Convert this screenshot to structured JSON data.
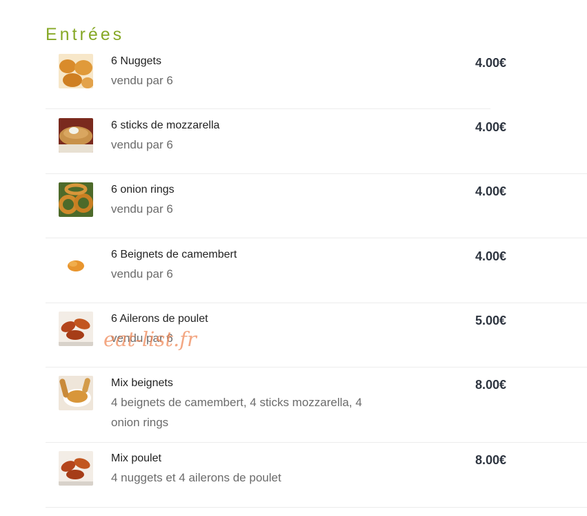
{
  "section": {
    "title": "Entrées"
  },
  "items": [
    {
      "name": "6 Nuggets",
      "description": "vendu par 6",
      "price": "4.00€",
      "thumb_icon": "nuggets-icon"
    },
    {
      "name": "6 sticks de mozzarella",
      "description": "vendu par 6",
      "price": "4.00€",
      "thumb_icon": "mozzarella-sticks-icon"
    },
    {
      "name": "6 onion rings",
      "description": "vendu par 6",
      "price": "4.00€",
      "thumb_icon": "onion-rings-icon"
    },
    {
      "name": "6 Beignets de camembert",
      "description": "vendu par 6",
      "price": "4.00€",
      "thumb_icon": "camembert-beignets-icon"
    },
    {
      "name": "6 Ailerons de poulet",
      "description": "vendu par 6",
      "price": "5.00€",
      "thumb_icon": "chicken-wings-icon"
    },
    {
      "name": "Mix beignets",
      "description": "4 beignets de camembert, 4 sticks mozzarella, 4 onion rings",
      "price": "8.00€",
      "thumb_icon": "mix-beignets-icon"
    },
    {
      "name": "Mix poulet",
      "description": "4 nuggets et 4 ailerons de poulet",
      "price": "8.00€",
      "thumb_icon": "mix-poulet-icon"
    }
  ],
  "watermark": {
    "text": "eat-list.fr"
  },
  "colors": {
    "title": "#86a826",
    "price": "#2e3540",
    "watermark": "#f08a5a"
  }
}
